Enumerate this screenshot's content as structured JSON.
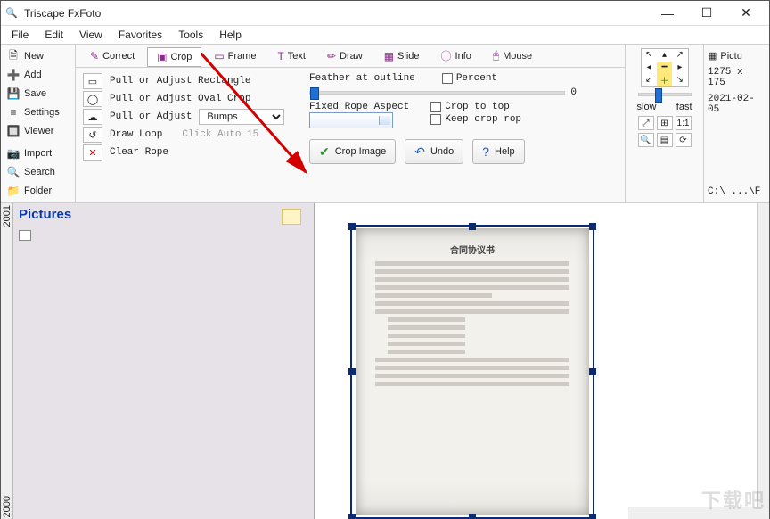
{
  "window": {
    "title": "Triscape FxFoto"
  },
  "winbtns": {
    "min": "—",
    "max": "☐",
    "close": "✕"
  },
  "menu": [
    "File",
    "Edit",
    "View",
    "Favorites",
    "Tools",
    "Help"
  ],
  "sidebar": [
    {
      "icon": "🗎",
      "label": "New"
    },
    {
      "icon": "➕",
      "label": "Add"
    },
    {
      "icon": "💾",
      "label": "Save"
    },
    {
      "icon": "≡",
      "label": "Settings"
    },
    {
      "icon": "🔲",
      "label": "Viewer"
    },
    {
      "icon": "📷",
      "label": "Import"
    },
    {
      "icon": "🔍",
      "label": "Search"
    },
    {
      "icon": "📁",
      "label": "Folder"
    }
  ],
  "tabs": [
    {
      "icon": "✎",
      "label": "Correct"
    },
    {
      "icon": "▣",
      "label": "Crop"
    },
    {
      "icon": "▭",
      "label": "Frame"
    },
    {
      "icon": "T",
      "label": "Text"
    },
    {
      "icon": "✏",
      "label": "Draw"
    },
    {
      "icon": "▦",
      "label": "Slide"
    },
    {
      "icon": "ⓘ",
      "label": "Info"
    },
    {
      "icon": "🖱",
      "label": "Mouse"
    }
  ],
  "shapes": {
    "rect": "Pull or Adjust Rectangle",
    "oval": "Pull or Adjust Oval Crop",
    "cloud": "Pull or Adjust",
    "cloud_sel": "Bumps",
    "loop": "Draw Loop",
    "loop_hint": "Click Auto  15",
    "clear": "Clear Rope"
  },
  "feather": {
    "label": "Feather at outline",
    "value": "0",
    "percent": "Percent"
  },
  "aspect": {
    "label": "Fixed Rope Aspect",
    "crop_top": "Crop to top",
    "keep": "Keep crop rop"
  },
  "buttons": {
    "crop": "Crop Image",
    "undo": "Undo",
    "help": "Help"
  },
  "nav": {
    "slow": "slow",
    "fast": "fast"
  },
  "far": {
    "pictu": "Pictu",
    "dims": "1275 x 175",
    "date": "2021-02-05",
    "path": "C:\\ ...\\F"
  },
  "left": {
    "header": "Pictures",
    "ruler_top": "2001",
    "ruler_bot": "2000"
  },
  "doc": {
    "title": "合同协议书"
  },
  "watermark": "下载吧"
}
